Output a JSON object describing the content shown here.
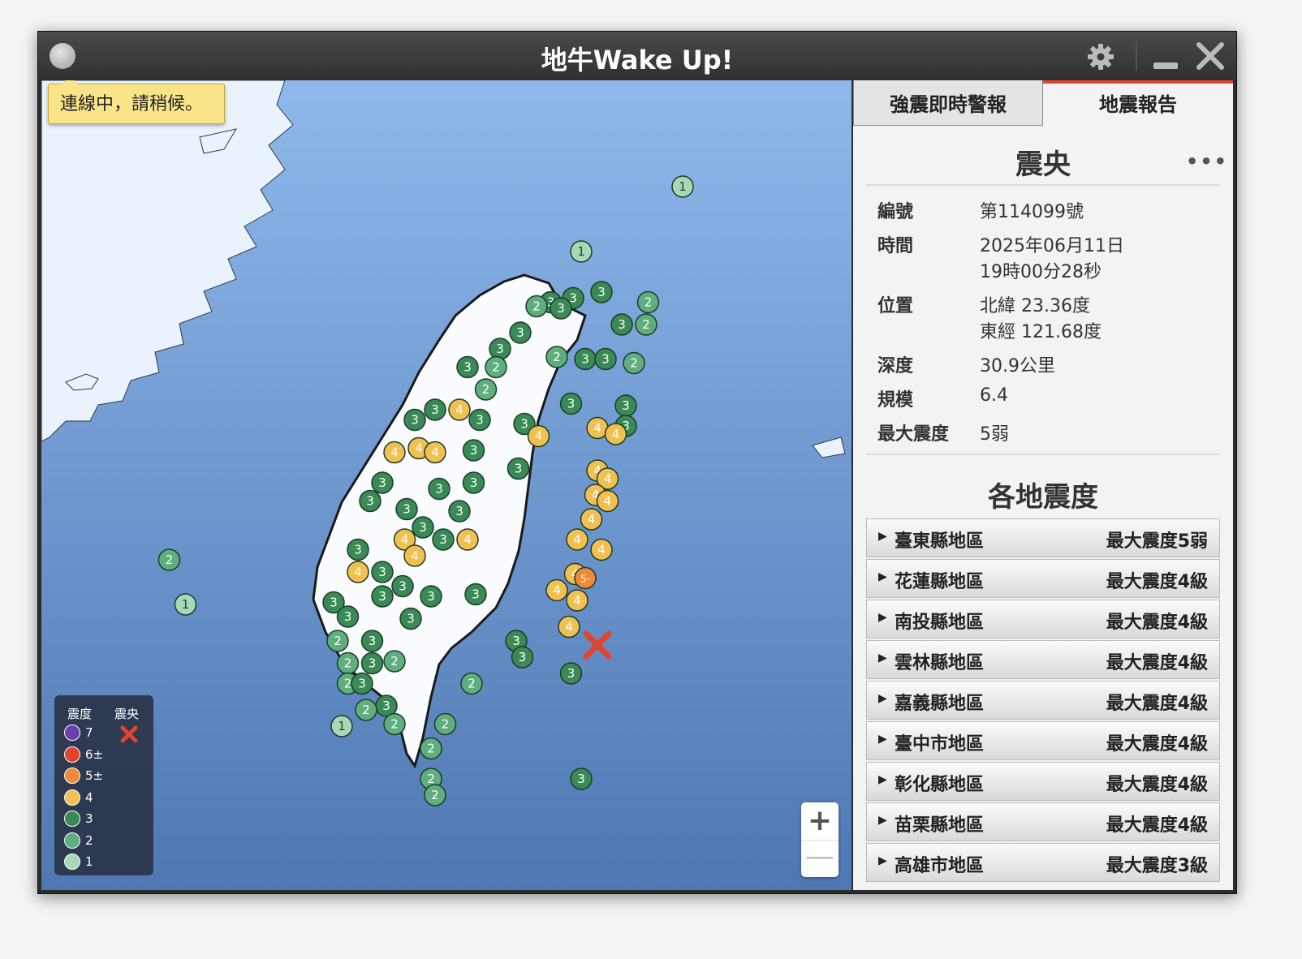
{
  "window": {
    "title": "地牛Wake Up!"
  },
  "status_toast": "連線中，請稍候。",
  "tabs": [
    {
      "label": "強震即時警報"
    },
    {
      "label": "地震報告"
    }
  ],
  "report": {
    "heading": "震央",
    "more": "•••",
    "fields": {
      "number_label": "編號",
      "number": "第114099號",
      "time_label": "時間",
      "date": "2025年06月11日",
      "time": "19時00分28秒",
      "location_label": "位置",
      "lat": "北緯 23.36度",
      "lon": "東經 121.68度",
      "depth_label": "深度",
      "depth": "30.9公里",
      "magnitude_label": "規模",
      "magnitude": "6.4",
      "max_label": "最大震度",
      "max": "5弱"
    }
  },
  "regions_heading": "各地震度",
  "regions": [
    {
      "name": "臺東縣地區",
      "max": "最大震度5弱"
    },
    {
      "name": "花蓮縣地區",
      "max": "最大震度4級"
    },
    {
      "name": "南投縣地區",
      "max": "最大震度4級"
    },
    {
      "name": "雲林縣地區",
      "max": "最大震度4級"
    },
    {
      "name": "嘉義縣地區",
      "max": "最大震度4級"
    },
    {
      "name": "臺中市地區",
      "max": "最大震度4級"
    },
    {
      "name": "彰化縣地區",
      "max": "最大震度4級"
    },
    {
      "name": "苗栗縣地區",
      "max": "最大震度4級"
    },
    {
      "name": "高雄市地區",
      "max": "最大震度3級"
    }
  ],
  "legend": {
    "intensity_label": "震度",
    "epicenter_label": "震央",
    "levels": [
      {
        "label": "7",
        "color": "#6a3fb0"
      },
      {
        "label": "6±",
        "color": "#e0442a"
      },
      {
        "label": "5±",
        "color": "#ef8a3a"
      },
      {
        "label": "4",
        "color": "#f0c050"
      },
      {
        "label": "3",
        "color": "#3a8a55"
      },
      {
        "label": "2",
        "color": "#5fae7d"
      },
      {
        "label": "1",
        "color": "#a7d8b8"
      }
    ]
  },
  "zoom": {
    "in": "+",
    "out": "—"
  },
  "stations": [
    {
      "i": "1",
      "lon": 122.1,
      "lat": 25.62
    },
    {
      "i": "1",
      "lon": 121.6,
      "lat": 25.3
    },
    {
      "i": "3",
      "lon": 121.7,
      "lat": 25.1
    },
    {
      "i": "3",
      "lon": 121.56,
      "lat": 25.07
    },
    {
      "i": "3",
      "lon": 121.45,
      "lat": 25.05
    },
    {
      "i": "2",
      "lon": 121.38,
      "lat": 25.03
    },
    {
      "i": "3",
      "lon": 121.5,
      "lat": 25.02
    },
    {
      "i": "2",
      "lon": 121.93,
      "lat": 25.05
    },
    {
      "i": "2",
      "lon": 121.92,
      "lat": 24.94
    },
    {
      "i": "3",
      "lon": 121.8,
      "lat": 24.94
    },
    {
      "i": "3",
      "lon": 121.3,
      "lat": 24.9
    },
    {
      "i": "3",
      "lon": 121.2,
      "lat": 24.82
    },
    {
      "i": "2",
      "lon": 121.48,
      "lat": 24.78
    },
    {
      "i": "3",
      "lon": 121.62,
      "lat": 24.77
    },
    {
      "i": "3",
      "lon": 121.72,
      "lat": 24.77
    },
    {
      "i": "2",
      "lon": 121.86,
      "lat": 24.75
    },
    {
      "i": "3",
      "lon": 121.04,
      "lat": 24.73
    },
    {
      "i": "2",
      "lon": 121.18,
      "lat": 24.73
    },
    {
      "i": "2",
      "lon": 121.13,
      "lat": 24.62
    },
    {
      "i": "3",
      "lon": 121.55,
      "lat": 24.55
    },
    {
      "i": "3",
      "lon": 121.82,
      "lat": 24.54
    },
    {
      "i": "3",
      "lon": 120.88,
      "lat": 24.52
    },
    {
      "i": "4",
      "lon": 121.0,
      "lat": 24.52
    },
    {
      "i": "3",
      "lon": 121.1,
      "lat": 24.47
    },
    {
      "i": "3",
      "lon": 120.78,
      "lat": 24.47
    },
    {
      "i": "3",
      "lon": 121.82,
      "lat": 24.44
    },
    {
      "i": "3",
      "lon": 121.32,
      "lat": 24.45
    },
    {
      "i": "4",
      "lon": 121.39,
      "lat": 24.39
    },
    {
      "i": "4",
      "lon": 121.68,
      "lat": 24.43
    },
    {
      "i": "4",
      "lon": 121.77,
      "lat": 24.4
    },
    {
      "i": "4",
      "lon": 120.68,
      "lat": 24.31
    },
    {
      "i": "4",
      "lon": 120.8,
      "lat": 24.33
    },
    {
      "i": "4",
      "lon": 120.88,
      "lat": 24.31
    },
    {
      "i": "3",
      "lon": 121.07,
      "lat": 24.32
    },
    {
      "i": "3",
      "lon": 121.29,
      "lat": 24.23
    },
    {
      "i": "4",
      "lon": 121.68,
      "lat": 24.22
    },
    {
      "i": "4",
      "lon": 121.73,
      "lat": 24.18
    },
    {
      "i": "3",
      "lon": 120.62,
      "lat": 24.16
    },
    {
      "i": "3",
      "lon": 120.9,
      "lat": 24.13
    },
    {
      "i": "3",
      "lon": 121.07,
      "lat": 24.16
    },
    {
      "i": "4",
      "lon": 121.67,
      "lat": 24.1
    },
    {
      "i": "4",
      "lon": 121.73,
      "lat": 24.07
    },
    {
      "i": "3",
      "lon": 120.56,
      "lat": 24.07
    },
    {
      "i": "3",
      "lon": 120.74,
      "lat": 24.03
    },
    {
      "i": "3",
      "lon": 121.0,
      "lat": 24.02
    },
    {
      "i": "4",
      "lon": 121.65,
      "lat": 23.98
    },
    {
      "i": "3",
      "lon": 120.82,
      "lat": 23.94
    },
    {
      "i": "4",
      "lon": 120.73,
      "lat": 23.88
    },
    {
      "i": "3",
      "lon": 120.92,
      "lat": 23.88
    },
    {
      "i": "4",
      "lon": 121.04,
      "lat": 23.88
    },
    {
      "i": "4",
      "lon": 121.58,
      "lat": 23.88
    },
    {
      "i": "4",
      "lon": 121.7,
      "lat": 23.83
    },
    {
      "i": "3",
      "lon": 120.5,
      "lat": 23.83
    },
    {
      "i": "4",
      "lon": 120.78,
      "lat": 23.8
    },
    {
      "i": "4",
      "lon": 120.5,
      "lat": 23.72
    },
    {
      "i": "3",
      "lon": 120.62,
      "lat": 23.72
    },
    {
      "i": "4",
      "lon": 121.57,
      "lat": 23.71
    },
    {
      "i": "5-",
      "lon": 121.62,
      "lat": 23.69
    },
    {
      "i": "3",
      "lon": 120.72,
      "lat": 23.65
    },
    {
      "i": "3",
      "lon": 120.62,
      "lat": 23.6
    },
    {
      "i": "3",
      "lon": 120.86,
      "lat": 23.6
    },
    {
      "i": "3",
      "lon": 121.08,
      "lat": 23.61
    },
    {
      "i": "4",
      "lon": 121.48,
      "lat": 23.63
    },
    {
      "i": "4",
      "lon": 121.58,
      "lat": 23.58
    },
    {
      "i": "3",
      "lon": 120.38,
      "lat": 23.57
    },
    {
      "i": "3",
      "lon": 120.45,
      "lat": 23.5
    },
    {
      "i": "3",
      "lon": 120.76,
      "lat": 23.49
    },
    {
      "i": "4",
      "lon": 121.54,
      "lat": 23.45
    },
    {
      "i": "2",
      "lon": 120.4,
      "lat": 23.38
    },
    {
      "i": "3",
      "lon": 120.57,
      "lat": 23.38
    },
    {
      "i": "3",
      "lon": 121.28,
      "lat": 23.38
    },
    {
      "i": "3",
      "lon": 121.31,
      "lat": 23.3
    },
    {
      "i": "2",
      "lon": 120.45,
      "lat": 23.27
    },
    {
      "i": "3",
      "lon": 120.57,
      "lat": 23.27
    },
    {
      "i": "2",
      "lon": 120.68,
      "lat": 23.28
    },
    {
      "i": "2",
      "lon": 120.45,
      "lat": 23.17
    },
    {
      "i": "3",
      "lon": 120.52,
      "lat": 23.17
    },
    {
      "i": "2",
      "lon": 121.06,
      "lat": 23.17
    },
    {
      "i": "3",
      "lon": 121.55,
      "lat": 23.22
    },
    {
      "i": "3",
      "lon": 120.64,
      "lat": 23.06
    },
    {
      "i": "2",
      "lon": 120.54,
      "lat": 23.04
    },
    {
      "i": "1",
      "lon": 120.42,
      "lat": 22.96
    },
    {
      "i": "2",
      "lon": 120.68,
      "lat": 22.97
    },
    {
      "i": "2",
      "lon": 120.93,
      "lat": 22.97
    },
    {
      "i": "2",
      "lon": 120.86,
      "lat": 22.85
    },
    {
      "i": "2",
      "lon": 120.86,
      "lat": 22.7
    },
    {
      "i": "2",
      "lon": 120.88,
      "lat": 22.62
    },
    {
      "i": "3",
      "lon": 121.6,
      "lat": 22.7
    },
    {
      "i": "2",
      "lon": 119.57,
      "lat": 23.78
    },
    {
      "i": "1",
      "lon": 119.65,
      "lat": 23.56
    }
  ],
  "epicenter": {
    "lon": 121.68,
    "lat": 23.36
  }
}
